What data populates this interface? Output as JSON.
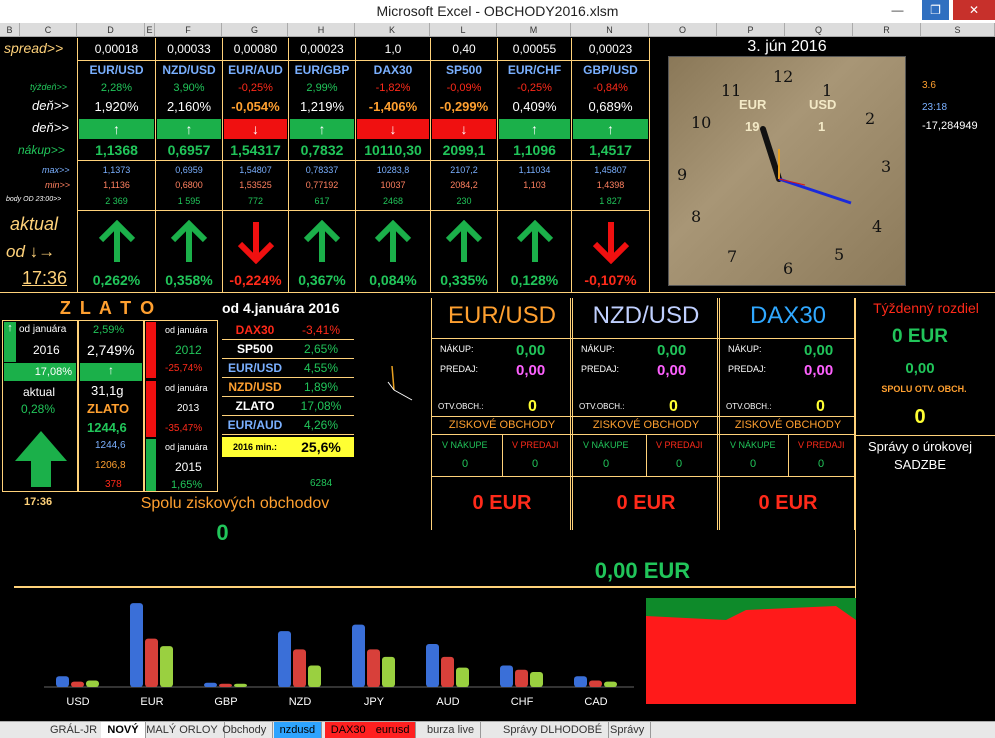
{
  "window": {
    "title": "Microsoft Excel - OBCHODY2016.xlsm"
  },
  "columns": [
    "B",
    "C",
    "D",
    "E",
    "F",
    "G",
    "H",
    "K",
    "L",
    "M",
    "N",
    "O",
    "P",
    "Q",
    "R",
    "S"
  ],
  "spread": {
    "label": "spread>>",
    "values": [
      "0,00018",
      "0,00033",
      "0,00080",
      "0,00023",
      "1,0",
      "0,40",
      "0,00055",
      "0,00023"
    ]
  },
  "pairs": [
    "EUR/USD",
    "NZD/USD",
    "EUR/AUD",
    "EUR/GBP",
    "DAX30",
    "SP500",
    "EUR/CHF",
    "GBP/USD"
  ],
  "week": {
    "label": "týždeň>>",
    "values": [
      "2,28%",
      "3,90%",
      "-0,25%",
      "2,99%",
      "-1,82%",
      "-0,09%",
      "-0,25%",
      "-0,84%"
    ]
  },
  "day": {
    "label": "deň>>",
    "values": [
      "1,920%",
      "2,160%",
      "-0,054%",
      "1,219%",
      "-1,406%",
      "-0,299%",
      "0,409%",
      "0,689%"
    ]
  },
  "day_dir": {
    "label": "deň>>",
    "dirs": [
      "up",
      "up",
      "down",
      "up",
      "down",
      "down",
      "up",
      "up"
    ]
  },
  "buy": {
    "label": "nákup>>",
    "values": [
      "1,1368",
      "0,6957",
      "1,54317",
      "0,7832",
      "10110,30",
      "2099,1",
      "1,1096",
      "1,4517"
    ]
  },
  "max": {
    "label": "max>>",
    "values": [
      "1,1373",
      "0,6959",
      "1,54807",
      "0,78337",
      "10283,8",
      "2107,2",
      "1,11034",
      "1,45807"
    ]
  },
  "min": {
    "label": "min>>",
    "values": [
      "1,1136",
      "0,6800",
      "1,53525",
      "0,77192",
      "10037",
      "2084,2",
      "1,103",
      "1,4398"
    ]
  },
  "body": {
    "label": "body OD 23:00>>",
    "values": [
      "2 369",
      "1 595",
      "772",
      "617",
      "2468",
      "230",
      "",
      "1 827"
    ]
  },
  "actual": {
    "label1": "aktual",
    "label2": "od ↓→",
    "time": "17:36",
    "values": [
      "0,262%",
      "0,358%",
      "-0,224%",
      "0,367%",
      "0,084%",
      "0,335%",
      "0,128%",
      "-0,107%"
    ],
    "dirs": [
      "up",
      "up",
      "down",
      "up",
      "up",
      "up",
      "up",
      "down"
    ]
  },
  "clock": {
    "date": "3. jún 2016",
    "eur_label": "EUR",
    "eur_val": "19",
    "usd_label": "USD",
    "usd_val": "1",
    "numbers": [
      "12",
      "1",
      "2",
      "3",
      "4",
      "5",
      "6",
      "7",
      "8",
      "9",
      "10",
      "11"
    ]
  },
  "side": {
    "v1": "3.6",
    "v2": "23:18",
    "v3": "-17,284949"
  },
  "gold": {
    "title": "Z L A T O",
    "since": "od 4.januára 2016",
    "col1": {
      "since": "od januára",
      "year": "2016",
      "pct": "17,08%",
      "actual_label": "aktual",
      "actual": "0,28%",
      "time": "17:36"
    },
    "col2": {
      "pct1": "2,59%",
      "pct2": "2,749%",
      "weight": "31,1g",
      "name": "ZLATO",
      "price": "1244,6",
      "v1": "1244,6",
      "v2": "1206,8",
      "v3": "378"
    },
    "col3": {
      "a_since": "od januára",
      "a_year": "2012",
      "a_pct": "-25,74%",
      "b_since": "od januára",
      "b_year": "2013",
      "b_pct": "-35,47%",
      "c_since": "od januára",
      "c_year": "2015",
      "c_pct": "1,65%"
    },
    "list": [
      {
        "name": "DAX30",
        "val": "-3,41%"
      },
      {
        "name": "SP500",
        "val": "2,65%"
      },
      {
        "name": "EUR/USD",
        "val": "4,55%"
      },
      {
        "name": "NZD/USD",
        "val": "1,89%"
      },
      {
        "name": "ZLATO",
        "val": "17,08%"
      },
      {
        "name": "EUR/AUD",
        "val": "4,26%"
      }
    ],
    "min_label": "2016 min.:",
    "min_val": "25,6%",
    "extra": "6284"
  },
  "profits": {
    "label": "Spolu ziskových obchodov",
    "value": "0"
  },
  "trades": [
    {
      "pair": "EUR/USD",
      "buy_label": "NÁKUP:",
      "buy": "0,00",
      "sell_label": "PREDAJ:",
      "sell": "0,00",
      "open_label": "OTV.OBCH.:",
      "open": "0",
      "win_label": "ZISKOVÉ OBCHODY",
      "in_buy": "V NÁKUPE",
      "in_buy_v": "0",
      "in_sell": "V PREDAJI",
      "in_sell_v": "0",
      "total": "0 EUR"
    },
    {
      "pair": "NZD/USD",
      "buy_label": "NÁKUP:",
      "buy": "0,00",
      "sell_label": "PREDAJ:",
      "sell": "0,00",
      "open_label": "OTV.OBCH.:",
      "open": "0",
      "win_label": "ZISKOVÉ OBCHODY",
      "in_buy": "V NÁKUPE",
      "in_buy_v": "0",
      "in_sell": "V PREDAJI",
      "in_sell_v": "0",
      "total": "0 EUR"
    },
    {
      "pair": "DAX30",
      "buy_label": "NÁKUP:",
      "buy": "0,00",
      "sell_label": "PREDAJ:",
      "sell": "0,00",
      "open_label": "OTV.OBCH.:",
      "open": "0",
      "win_label": "ZISKOVÉ OBCHODY",
      "in_buy": "V NÁKUPE",
      "in_buy_v": "0",
      "in_sell": "V PREDAJI",
      "in_sell_v": "0",
      "total": "0 EUR"
    }
  ],
  "weekly": {
    "title": "Týždenný rozdiel",
    "eur": "0 EUR",
    "val": "0,00",
    "open_label": "SPOLU OTV. OBCH.",
    "open": "0",
    "news1": "Správy o úrokovej",
    "news2": "SADZBE"
  },
  "grand_total": "0,00 EUR",
  "colors": {
    "up": "#21c55a",
    "down": "#ff2a1a",
    "accent": "#ffd27a"
  },
  "chart_data": {
    "type": "bar",
    "categories": [
      "USD",
      "EUR",
      "GBP",
      "NZD",
      "JPY",
      "AUD",
      "CHF",
      "CAD"
    ],
    "series": [
      {
        "values": [
          10,
          78,
          4,
          52,
          58,
          40,
          20,
          10
        ],
        "color": "#3a6fd8"
      },
      {
        "values": [
          5,
          45,
          3,
          35,
          35,
          28,
          16,
          6
        ],
        "color": "#d8403a"
      },
      {
        "values": [
          6,
          38,
          3,
          20,
          28,
          18,
          14,
          5
        ],
        "color": "#9ad040"
      }
    ]
  },
  "tabs": [
    "GRÁL-JR",
    "NOVÝ",
    "MALÝ ORLOY",
    "Obchody",
    "nzdusd",
    "DAX30",
    "eurusd",
    "burza live",
    "Správy DLHODOBÉ",
    "Správy"
  ]
}
